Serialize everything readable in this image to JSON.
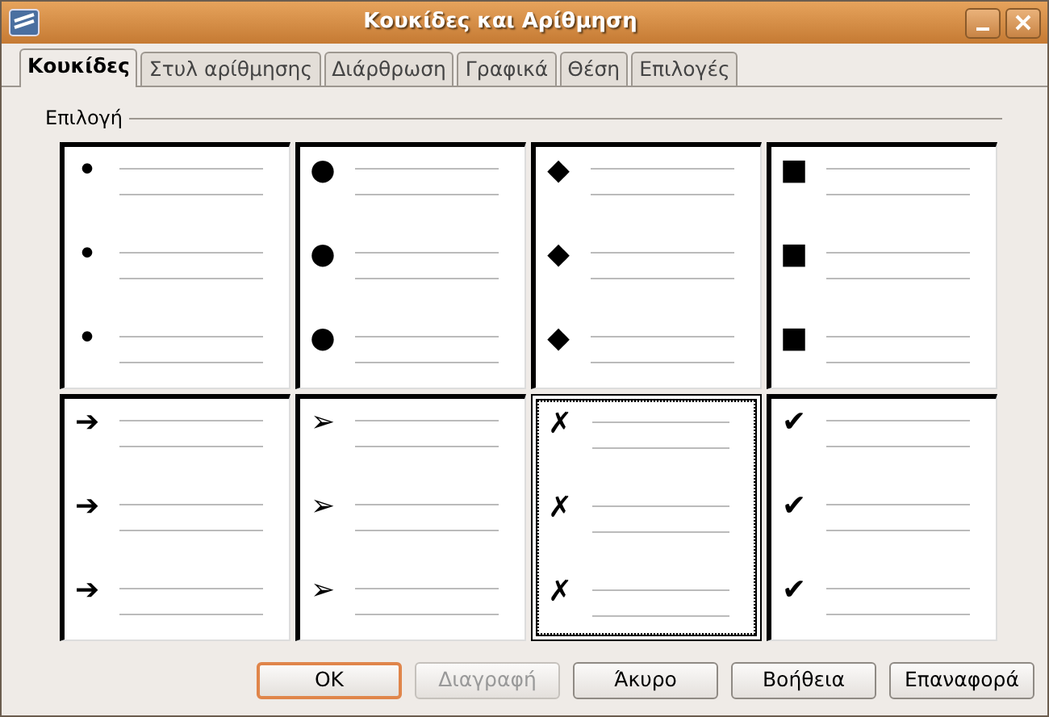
{
  "window": {
    "title": "Κουκίδες και Αρίθμηση"
  },
  "tabs": [
    {
      "label": "Κουκίδες",
      "selected": true
    },
    {
      "label": "Στυλ αρίθμησης",
      "selected": false
    },
    {
      "label": "Διάρθρωση",
      "selected": false
    },
    {
      "label": "Γραφικά",
      "selected": false
    },
    {
      "label": "Θέση",
      "selected": false
    },
    {
      "label": "Επιλογές",
      "selected": false
    }
  ],
  "section": {
    "label": "Επιλογή"
  },
  "tiles": [
    {
      "bullets": [
        "•",
        "•",
        "•"
      ],
      "selected": false
    },
    {
      "bullets": [
        "●",
        "●",
        "●"
      ],
      "selected": false
    },
    {
      "bullets": [
        "◆",
        "◆",
        "◆"
      ],
      "selected": false
    },
    {
      "bullets": [
        "■",
        "■",
        "■"
      ],
      "selected": false
    },
    {
      "bullets": [
        "➔",
        "➔",
        "➔"
      ],
      "selected": false
    },
    {
      "bullets": [
        "➢",
        "➢",
        "➢"
      ],
      "selected": false
    },
    {
      "bullets": [
        "✗",
        "✗",
        "✗"
      ],
      "selected": true
    },
    {
      "bullets": [
        "✔",
        "✔",
        "✔"
      ],
      "selected": false
    }
  ],
  "buttons": [
    {
      "label": "OK",
      "default": true,
      "disabled": false
    },
    {
      "label": "Διαγραφή",
      "default": false,
      "disabled": true
    },
    {
      "label": "Άκυρο",
      "default": false,
      "disabled": false
    },
    {
      "label": "Βοήθεια",
      "default": false,
      "disabled": false
    },
    {
      "label": "Επαναφορά",
      "default": false,
      "disabled": false
    }
  ]
}
